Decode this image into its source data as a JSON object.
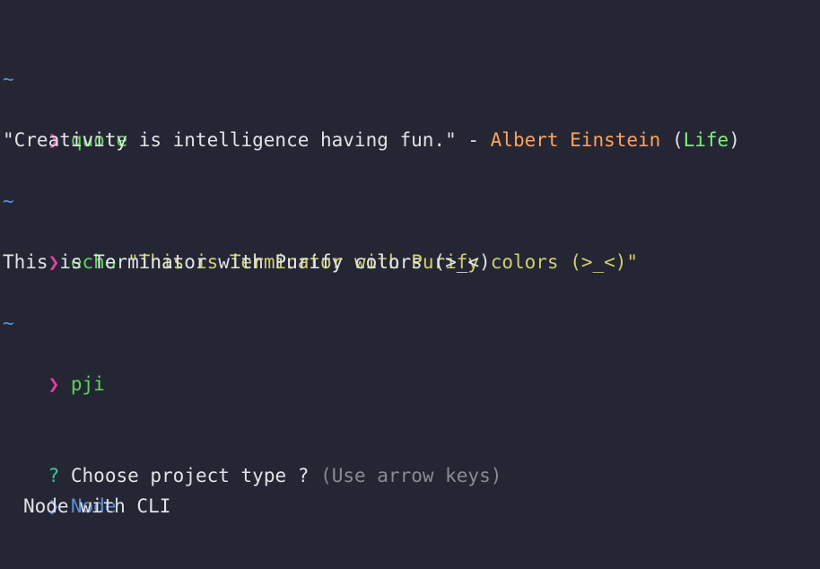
{
  "colors": {
    "background": "#252634",
    "tilde": "#5b8fd8",
    "prompt": "#e83ea0",
    "command": "#5dd45d",
    "string": "#cfd06a",
    "output": "#e2e2e6",
    "author": "#ffa35a",
    "topic": "#7ef07c",
    "question_mark": "#3ec89a",
    "hint": "#8b8b92",
    "selected": "#5b8fd8"
  },
  "blocks": [
    {
      "cwd": "~",
      "prompt_symbol": "❯",
      "command": "quote",
      "output": {
        "quote_text": "\"Creativity is intelligence having fun.\" - ",
        "author": "Albert Einstein",
        "topic_open": " (",
        "topic": "Life",
        "topic_close": ")"
      }
    },
    {
      "cwd": "~",
      "prompt_symbol": "❯",
      "command": "echo",
      "argument": "\"This is Terminator with Purify colors (>_<)\"",
      "output": "This is Terminator with Purify colors (>_<)"
    },
    {
      "cwd": "~",
      "prompt_symbol": "❯",
      "command": "pji"
    }
  ],
  "menu": {
    "question_mark": "?",
    "question": "Choose project type ?",
    "hint": "(Use arrow keys)",
    "pointer": "❯",
    "options": [
      "Node",
      "Node with CLI"
    ],
    "selected_index": 0
  }
}
